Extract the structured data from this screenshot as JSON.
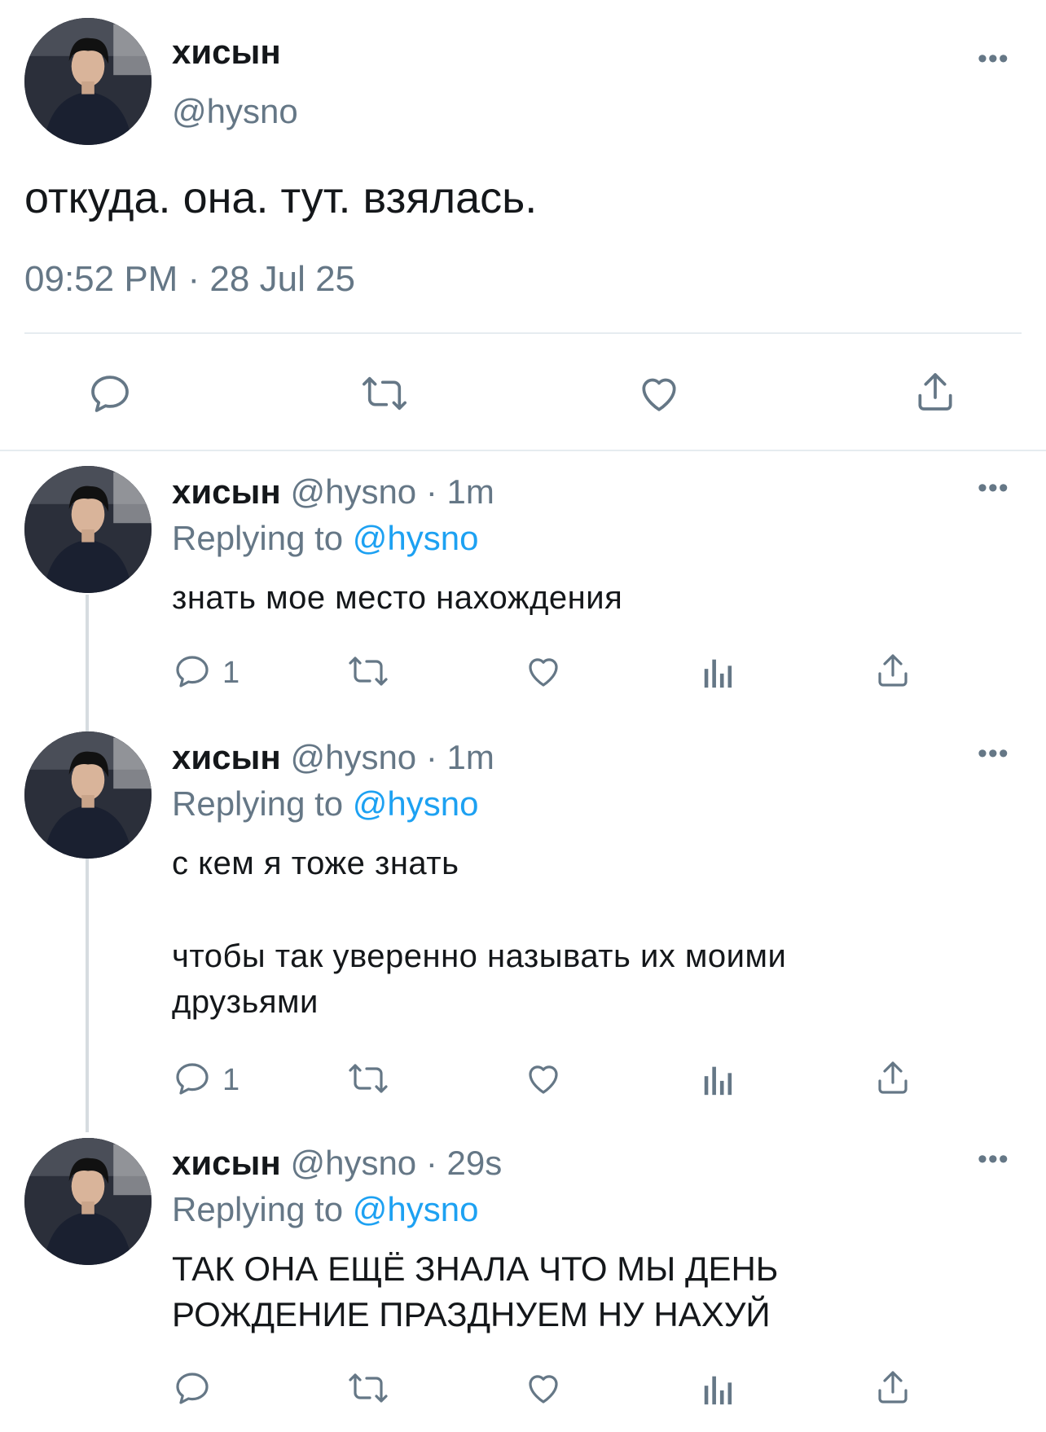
{
  "main_tweet": {
    "display_name": "хисын",
    "handle": "@hysno",
    "text": "откуда. она. тут. взялась.",
    "timestamp": "09:52 PM · 28 Jul 25",
    "more_icon": "more-dots-icon",
    "actions": [
      "reply-icon",
      "retweet-icon",
      "like-icon",
      "share-icon"
    ]
  },
  "replies": [
    {
      "display_name": "хисын",
      "handle_time": "@hysno · 1m",
      "replying_prefix": "Replying to",
      "replying_handle": "@hysno",
      "text_lines": [
        "знать мое место нахождения"
      ],
      "reply_count": "1"
    },
    {
      "display_name": "хисын",
      "handle_time": "@hysno · 1m",
      "replying_prefix": "Replying to",
      "replying_handle": "@hysno",
      "text_lines": [
        "с кем я тоже знать",
        "",
        "чтобы так уверенно называть их моими",
        "друзьями"
      ],
      "reply_count": "1"
    },
    {
      "display_name": "хисын",
      "handle_time": "@hysno · 29s",
      "replying_prefix": "Replying to",
      "replying_handle": "@hysno",
      "text_lines": [
        "ТАК ОНА ЕЩЁ ЗНАЛА ЧТО МЫ ДЕНЬ",
        "РОЖДЕНИЕ ПРАЗДНУЕМ НУ НАХУЙ"
      ],
      "reply_count": ""
    }
  ],
  "colors": {
    "text": "#14171a",
    "secondary": "#657786",
    "accent": "#1da1f2",
    "divider": "#e6ecf0"
  }
}
